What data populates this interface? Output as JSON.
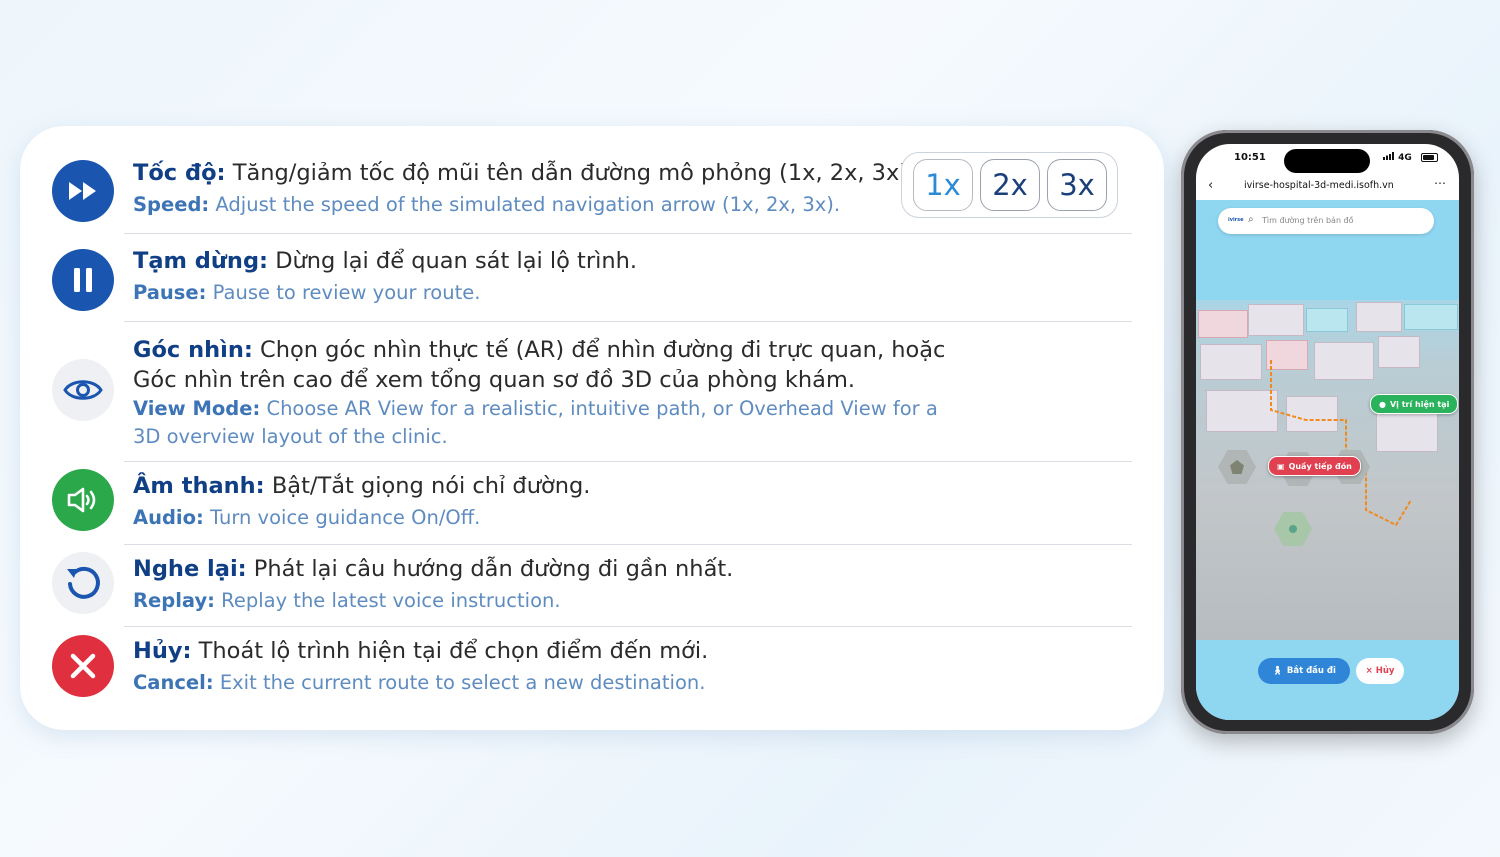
{
  "rows": [
    {
      "vi_label": "Tốc độ:",
      "vi_text": " Tăng/giảm tốc độ mũi tên dẫn đường mô phỏng (1x, 2x, 3x).",
      "en_label": "Speed:",
      "en_text": " Adjust the speed of the simulated navigation arrow (1x, 2x, 3x).",
      "icon": "fast-forward-icon"
    },
    {
      "vi_label": "Tạm dừng:",
      "vi_text": " Dừng lại để quan sát lại lộ trình.",
      "en_label": "Pause:",
      "en_text": " Pause to review your route.",
      "icon": "pause-icon"
    },
    {
      "vi_label": "Góc nhìn:",
      "vi_text": " Chọn góc nhìn thực tế (AR) để nhìn đường đi trực quan, hoặc",
      "vi_text2": "Góc nhìn trên cao để xem tổng quan sơ đồ 3D của phòng khám.",
      "en_label": "View Mode:",
      "en_text": "  Choose AR View for a realistic, intuitive path, or Overhead View for a",
      "en_text2": "3D overview layout of the clinic.",
      "icon": "eye-icon"
    },
    {
      "vi_label": "Âm thanh:",
      "vi_text": " Bật/Tắt giọng nói chỉ đường.",
      "en_label": "Audio:",
      "en_text": " Turn voice guidance On/Off.",
      "icon": "speaker-icon"
    },
    {
      "vi_label": "Nghe lại:",
      "vi_text": " Phát lại câu hướng dẫn đường đi gần nhất.",
      "en_label": "Replay:",
      "en_text": " Replay the latest voice instruction.",
      "icon": "replay-icon"
    },
    {
      "vi_label": "Hủy:",
      "vi_text": " Thoát lộ trình hiện tại để chọn điểm đến mới.",
      "en_label": "Cancel:",
      "en_text": " Exit the current route to select a new destination.",
      "icon": "close-icon"
    }
  ],
  "speed_buttons": [
    "1x",
    "2x",
    "3x"
  ],
  "speed_active": "1x",
  "phone": {
    "time": "10:51",
    "network": "4G",
    "url": "ivirse-hospital-3d-medi.isofh.vn",
    "search_placeholder": "Tìm đường trên bản đồ",
    "search_logo": "ivirse",
    "tag_current": "Vị trí hiện tại",
    "tag_reception": "Quầy tiếp đón",
    "start_button": "Bắt đầu đi",
    "cancel_button": "Hủy"
  },
  "colors": {
    "accent_blue": "#1a56b0",
    "label_blue": "#113f86",
    "english_blue": "#5f8cc0",
    "audio_green": "#2aa84a",
    "cancel_red": "#e0303f"
  }
}
